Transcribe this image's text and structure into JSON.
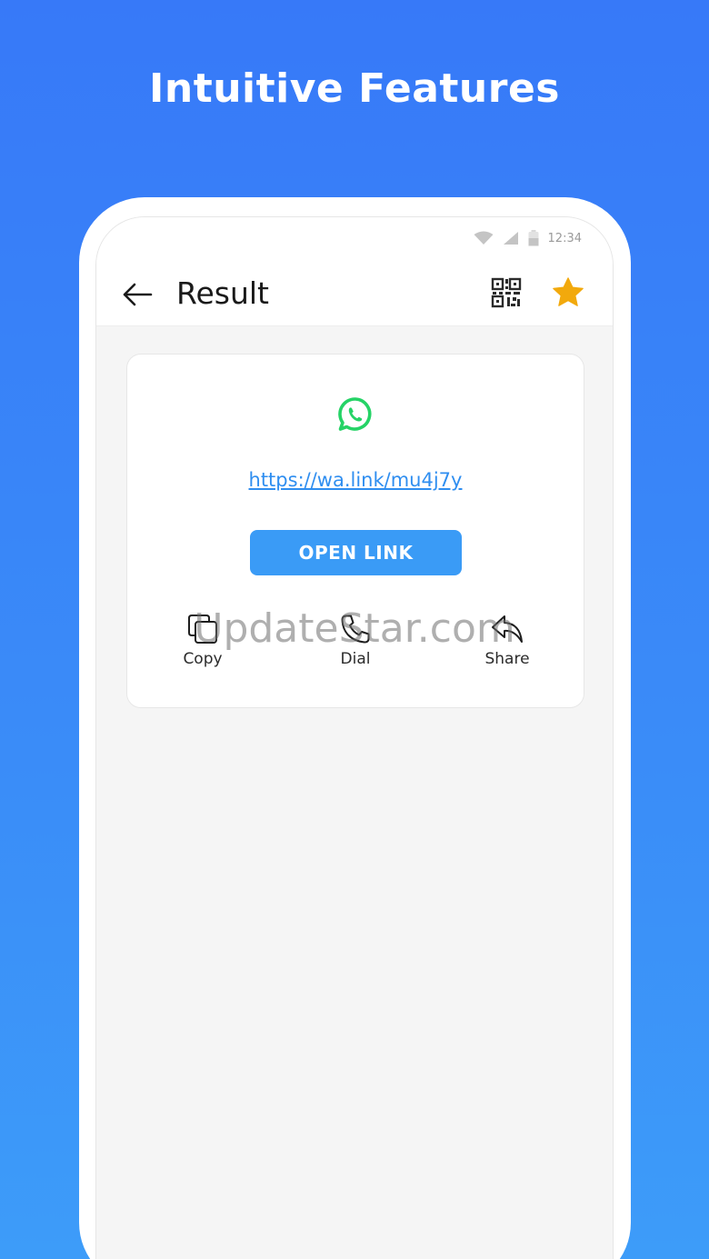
{
  "headline": "Intuitive Features",
  "status_bar": {
    "time": "12:34"
  },
  "app_bar": {
    "title": "Result"
  },
  "result": {
    "link": "https://wa.link/mu4j7y",
    "open_button": "OPEN LINK"
  },
  "actions": [
    {
      "label": "Copy",
      "icon": "copy-icon"
    },
    {
      "label": "Dial",
      "icon": "phone-icon"
    },
    {
      "label": "Share",
      "icon": "share-icon"
    }
  ],
  "watermark": "UpdateStar.com",
  "colors": {
    "background_top": "#3779f8",
    "background_bottom": "#3d9cf9",
    "accent_blue": "#3a9bf6",
    "link_blue": "#2f8ef0",
    "star": "#f2a90c",
    "whatsapp_green": "#25d366"
  }
}
